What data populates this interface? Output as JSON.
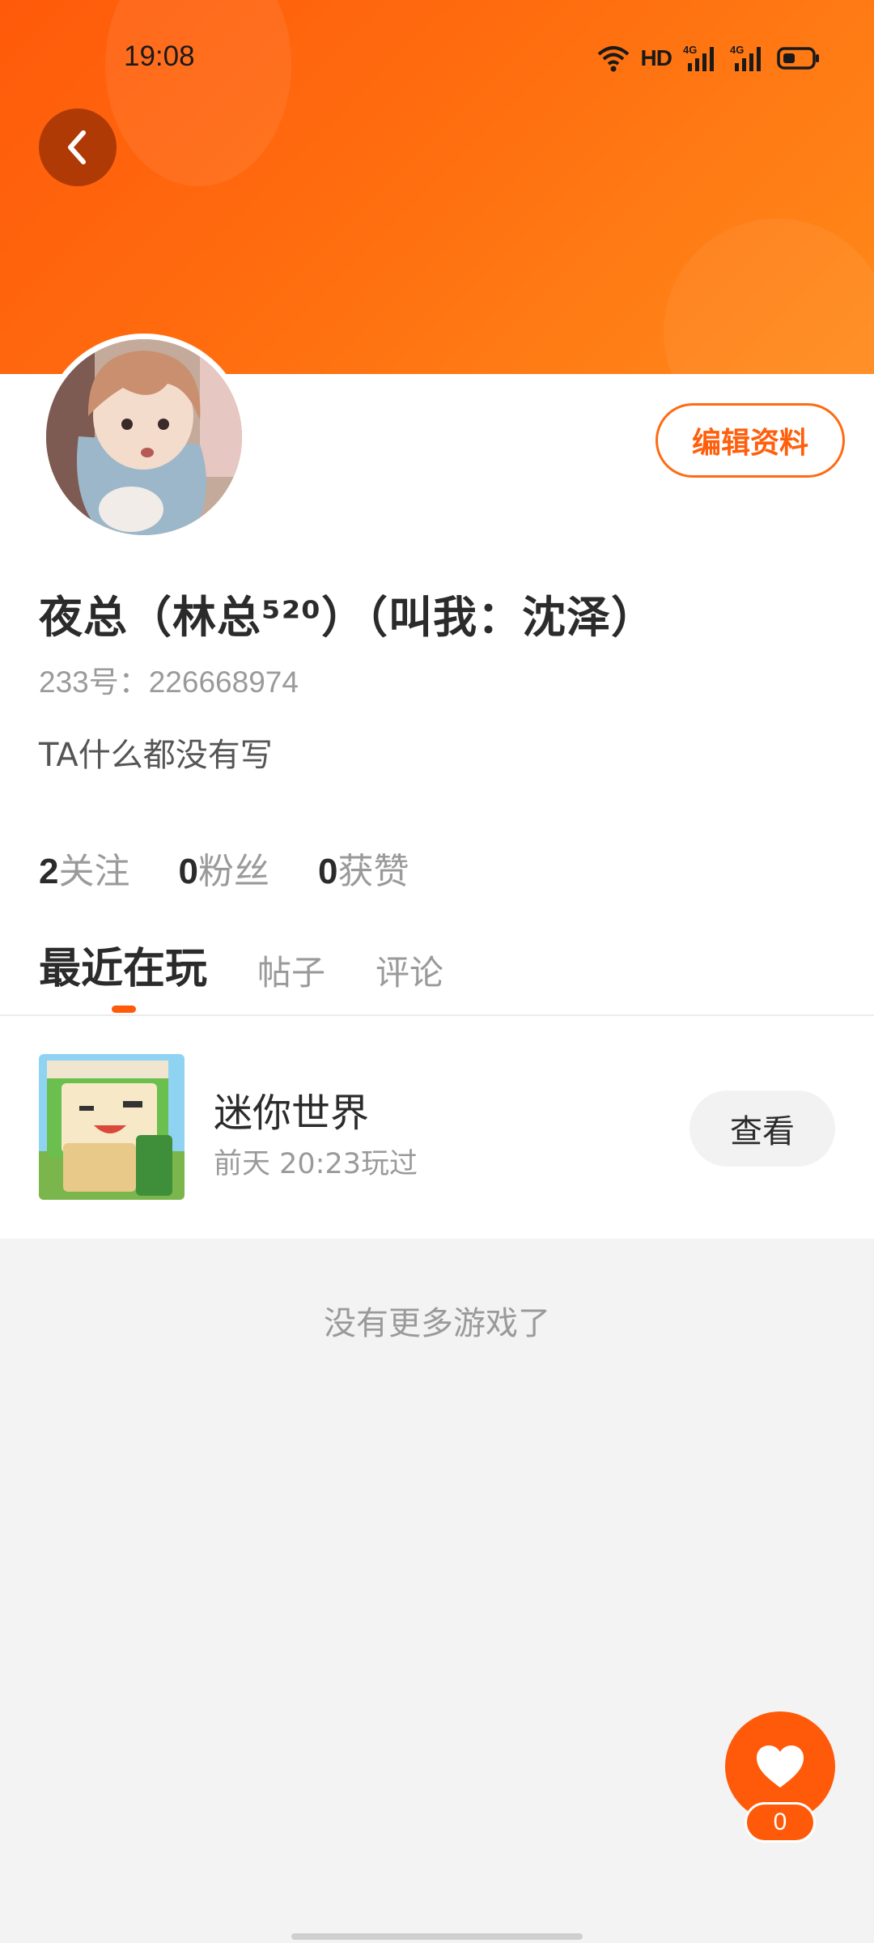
{
  "status_bar": {
    "time": "19:08",
    "network_label": "HD",
    "signal_labels": [
      "4G",
      "4G"
    ],
    "icons": [
      "wifi-icon",
      "signal-icon",
      "signal-icon",
      "battery-icon"
    ]
  },
  "header": {
    "back_icon": "chevron-left-icon",
    "colors": {
      "gradient_start": "#ff5a0a",
      "gradient_end": "#ff8a1a"
    }
  },
  "profile": {
    "edit_label": "编辑资料",
    "username": "夜总（林总⁵²⁰）（叫我：沈泽）",
    "id_text": "233号：226668974",
    "bio": "TA什么都没有写",
    "stats": [
      {
        "num": "2",
        "label": "关注"
      },
      {
        "num": "0",
        "label": "粉丝"
      },
      {
        "num": "0",
        "label": "获赞"
      }
    ]
  },
  "tabs": [
    {
      "label": "最近在玩",
      "active": true
    },
    {
      "label": "帖子",
      "active": false
    },
    {
      "label": "评论",
      "active": false
    }
  ],
  "games": [
    {
      "name": "迷你世界",
      "last_played": "前天 20:23玩过",
      "action_label": "查看"
    }
  ],
  "footer": {
    "no_more": "没有更多游戏了"
  },
  "like_fab": {
    "icon": "heart-icon",
    "count": "0"
  },
  "accent_color": "#ff5a0a"
}
